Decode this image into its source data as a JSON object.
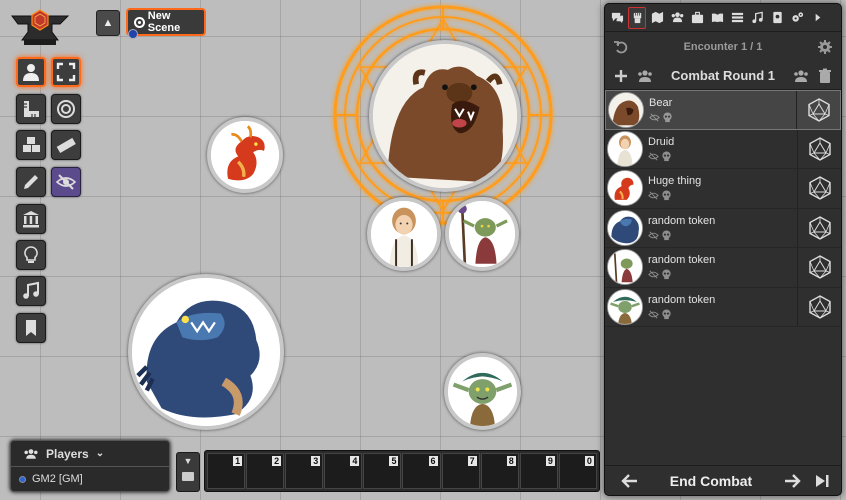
{
  "scene": {
    "new_scene_label": "New Scene"
  },
  "players": {
    "title": "Players",
    "users": [
      {
        "name": "GM2 [GM]"
      }
    ]
  },
  "hotbar": {
    "slots": [
      "1",
      "2",
      "3",
      "4",
      "5",
      "6",
      "7",
      "8",
      "9",
      "0"
    ],
    "page": "1"
  },
  "sidebar": {
    "tabs": [
      "chat",
      "combat",
      "scenes",
      "actors",
      "items",
      "journal",
      "tables",
      "playlists",
      "compendium",
      "settings",
      "collapse"
    ],
    "active_tab": "combat",
    "encounter_label": "Encounter 1 / 1",
    "round_label": "Combat Round 1",
    "combatants": [
      {
        "name": "Bear",
        "active": true
      },
      {
        "name": "Druid",
        "active": false
      },
      {
        "name": "Huge thing",
        "active": false
      },
      {
        "name": "random token",
        "active": false
      },
      {
        "name": "random token",
        "active": false
      },
      {
        "name": "random token",
        "active": false
      }
    ],
    "end_combat_label": "End Combat"
  },
  "colors": {
    "accent": "#ff6a1a",
    "sidebar_bg": "#2f2f2f",
    "canvas_bg": "#bdbdbd"
  }
}
